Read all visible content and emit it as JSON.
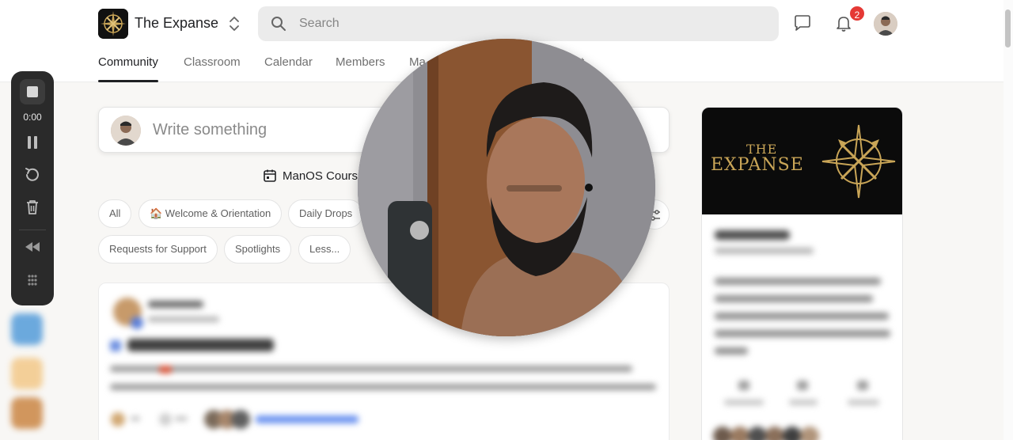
{
  "header": {
    "group_name": "The Expanse",
    "search_placeholder": "Search",
    "notification_count": "2"
  },
  "tabs": [
    {
      "label": "Community",
      "active": true
    },
    {
      "label": "Classroom",
      "active": false
    },
    {
      "label": "Calendar",
      "active": false
    },
    {
      "label": "Members",
      "active": false
    },
    {
      "label": "Ma",
      "active": false
    },
    {
      "label": "t",
      "active": false
    }
  ],
  "recorder": {
    "time": "0:00"
  },
  "composer": {
    "placeholder": "Write something"
  },
  "event_bar": {
    "text": "ManOS Course"
  },
  "filters": [
    {
      "label": "All"
    },
    {
      "label": "🏠 Welcome & Orientation"
    },
    {
      "label": "Daily Drops"
    },
    {
      "label": "Requests for Support"
    },
    {
      "label": "Spotlights"
    },
    {
      "label": "Less..."
    }
  ],
  "about": {
    "banner_line1": "THE",
    "banner_line2": "EXPANSE"
  },
  "colors": {
    "accent_gold": "#c9a557",
    "badge_red": "#e53935",
    "recorder_bg": "#2a2a2a"
  }
}
